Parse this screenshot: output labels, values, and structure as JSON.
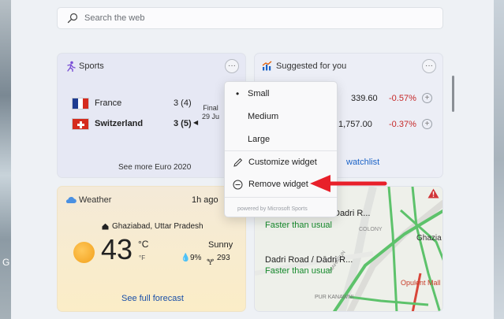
{
  "search": {
    "placeholder": "Search the web"
  },
  "sports": {
    "title": "Sports",
    "teams": [
      {
        "name": "France",
        "score": "3 (4)"
      },
      {
        "name": "Switzerland",
        "score": "3 (5)"
      }
    ],
    "status_line1": "Final",
    "status_line2": "29 Ju",
    "see_more": "See more Euro 2020"
  },
  "suggested": {
    "title": "Suggested for you",
    "stocks": [
      {
        "price": "339.60",
        "change": "-0.57%"
      },
      {
        "price": "1,757.00",
        "change": "-0.37%"
      }
    ],
    "watchlist_link": "watchlist"
  },
  "weather": {
    "title": "Weather",
    "updated": "1h ago",
    "location": "Ghaziabad, Uttar Pradesh",
    "temperature": "43",
    "unit_c": "°C",
    "unit_f": "°F",
    "condition": "Sunny",
    "precipitation": "9%",
    "aqi": "293",
    "forecast_link": "See full forecast"
  },
  "traffic": {
    "road1": "Dadri R...",
    "road1_status": "Faster than usual",
    "road2": "Dadri Road / Dādri R...",
    "road2_status": "Faster than usual",
    "map_labels": [
      "COLONY",
      "Ghazia",
      "Opulent Mall",
      "PUR KANAWNI",
      "MAHAGUN"
    ]
  },
  "menu": {
    "items": [
      "Small",
      "Medium",
      "Large",
      "Customize widget",
      "Remove widget"
    ],
    "selected": "Small",
    "powered_by": "powered by Microsoft Sports"
  },
  "desktop": {
    "glyph": "G"
  },
  "colors": {
    "accent_red": "#e8202a",
    "negative": "#c62828",
    "link": "#1a62c7",
    "traffic_green": "#168a2c"
  }
}
